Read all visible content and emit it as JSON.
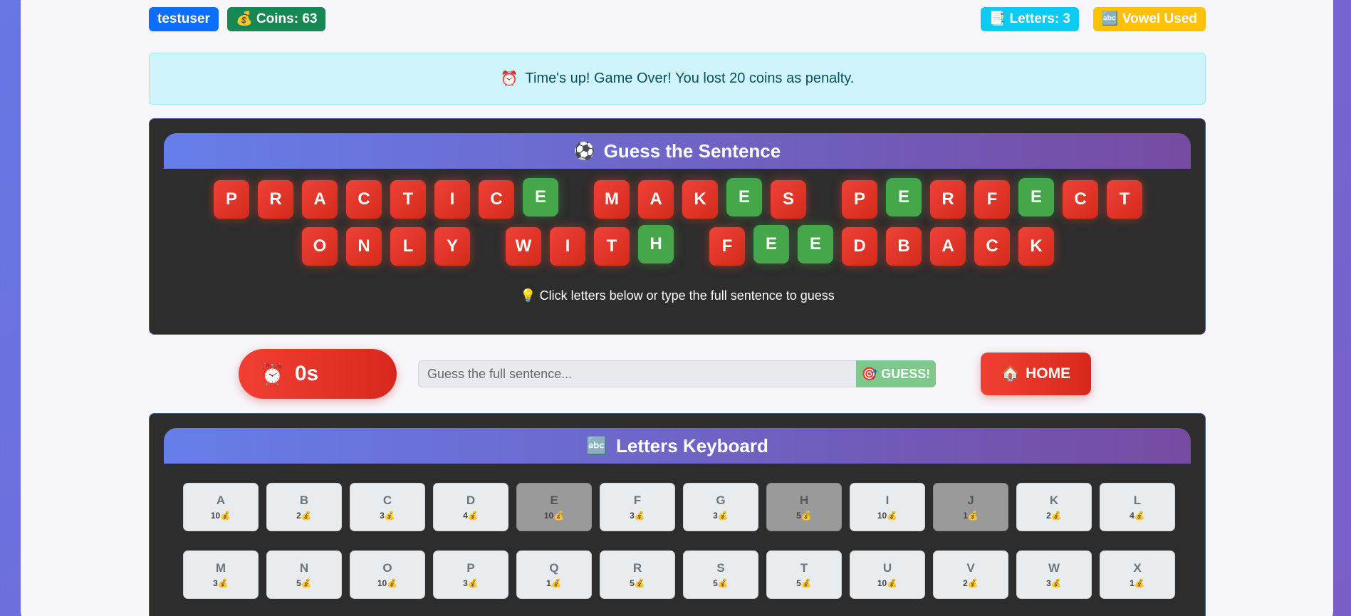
{
  "header": {
    "username": "testuser",
    "coins_label": "💰 Coins: 63",
    "letters_label": "📑 Letters: 3",
    "vowel_label": "🔤 Vowel Used"
  },
  "alert": {
    "icon": "alarm-clock-icon",
    "icon_glyph": "⏰",
    "message": "Time's up! Game Over! You lost 20 coins as penalty."
  },
  "puzzle": {
    "title_icon": "⚽",
    "title": "Guess the Sentence",
    "rows": [
      [
        {
          "ch": "P",
          "revealed": false
        },
        {
          "ch": "R",
          "revealed": false
        },
        {
          "ch": "A",
          "revealed": false
        },
        {
          "ch": "C",
          "revealed": false
        },
        {
          "ch": "T",
          "revealed": false
        },
        {
          "ch": "I",
          "revealed": false
        },
        {
          "ch": "C",
          "revealed": false
        },
        {
          "ch": "E",
          "revealed": true
        },
        {
          "space": true
        },
        {
          "ch": "M",
          "revealed": false
        },
        {
          "ch": "A",
          "revealed": false
        },
        {
          "ch": "K",
          "revealed": false
        },
        {
          "ch": "E",
          "revealed": true
        },
        {
          "ch": "S",
          "revealed": false
        },
        {
          "space": true
        },
        {
          "ch": "P",
          "revealed": false
        },
        {
          "ch": "E",
          "revealed": true
        },
        {
          "ch": "R",
          "revealed": false
        },
        {
          "ch": "F",
          "revealed": false
        },
        {
          "ch": "E",
          "revealed": true
        },
        {
          "ch": "C",
          "revealed": false
        },
        {
          "ch": "T",
          "revealed": false
        }
      ],
      [
        {
          "ch": "O",
          "revealed": false
        },
        {
          "ch": "N",
          "revealed": false
        },
        {
          "ch": "L",
          "revealed": false
        },
        {
          "ch": "Y",
          "revealed": false
        },
        {
          "space": true
        },
        {
          "ch": "W",
          "revealed": false
        },
        {
          "ch": "I",
          "revealed": false
        },
        {
          "ch": "T",
          "revealed": false
        },
        {
          "ch": "H",
          "revealed": true
        },
        {
          "space": true
        },
        {
          "ch": "F",
          "revealed": false
        },
        {
          "ch": "E",
          "revealed": true
        },
        {
          "ch": "E",
          "revealed": true
        },
        {
          "ch": "D",
          "revealed": false
        },
        {
          "ch": "B",
          "revealed": false
        },
        {
          "ch": "A",
          "revealed": false
        },
        {
          "ch": "C",
          "revealed": false
        },
        {
          "ch": "K",
          "revealed": false
        }
      ]
    ],
    "hint": "💡 Click letters below or type the full sentence to guess"
  },
  "controls": {
    "timer_icon": "⏰",
    "timer_value": "0s",
    "guess_placeholder": "Guess the full sentence...",
    "guess_button": "🎯 GUESS!",
    "home_icon": "🏠",
    "home_button": "HOME"
  },
  "keyboard": {
    "title_icon": "🔤",
    "title": "Letters Keyboard",
    "coin_glyph": "💰",
    "keys": [
      {
        "letter": "A",
        "cost": "10",
        "used": false
      },
      {
        "letter": "B",
        "cost": "2",
        "used": false
      },
      {
        "letter": "C",
        "cost": "3",
        "used": false
      },
      {
        "letter": "D",
        "cost": "4",
        "used": false
      },
      {
        "letter": "E",
        "cost": "10",
        "used": true
      },
      {
        "letter": "F",
        "cost": "3",
        "used": false
      },
      {
        "letter": "G",
        "cost": "3",
        "used": false
      },
      {
        "letter": "H",
        "cost": "5",
        "used": true
      },
      {
        "letter": "I",
        "cost": "10",
        "used": false
      },
      {
        "letter": "J",
        "cost": "1",
        "used": true
      },
      {
        "letter": "K",
        "cost": "2",
        "used": false
      },
      {
        "letter": "L",
        "cost": "4",
        "used": false
      },
      {
        "letter": "M",
        "cost": "3",
        "used": false
      },
      {
        "letter": "N",
        "cost": "5",
        "used": false
      },
      {
        "letter": "O",
        "cost": "10",
        "used": false
      },
      {
        "letter": "P",
        "cost": "3",
        "used": false
      },
      {
        "letter": "Q",
        "cost": "1",
        "used": false
      },
      {
        "letter": "R",
        "cost": "5",
        "used": false
      },
      {
        "letter": "S",
        "cost": "5",
        "used": false
      },
      {
        "letter": "T",
        "cost": "5",
        "used": false
      },
      {
        "letter": "U",
        "cost": "10",
        "used": false
      },
      {
        "letter": "V",
        "cost": "2",
        "used": false
      },
      {
        "letter": "W",
        "cost": "3",
        "used": false
      },
      {
        "letter": "X",
        "cost": "1",
        "used": false
      }
    ]
  },
  "colors": {
    "revealed": "#46a74a",
    "hidden": "#e53527",
    "accent_start": "#667eea",
    "accent_end": "#764ba2"
  }
}
